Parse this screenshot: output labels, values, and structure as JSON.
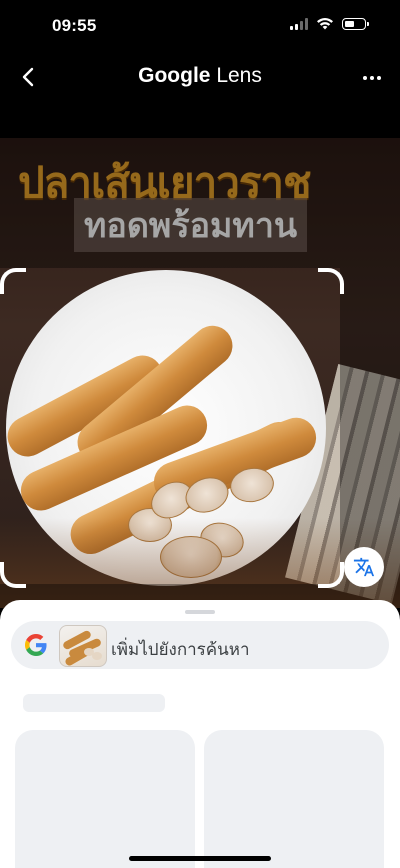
{
  "status_bar": {
    "time": "09:55",
    "icons": [
      "cellular-signal-icon",
      "wifi-icon",
      "battery-icon"
    ]
  },
  "nav": {
    "back_icon": "chevron-left-icon",
    "title_brand": "Google",
    "title_product": "Lens",
    "more_icon": "more-horizontal-icon"
  },
  "photo": {
    "banner_text": "ปลาเส้นเยาวราช",
    "subbanner_text": "ทอดพร้อมทาน"
  },
  "translate_button": {
    "icon": "translate-icon"
  },
  "sheet": {
    "search_pill": {
      "logo": "google-g-icon",
      "label": "เพิ่มไปยังการค้นหา"
    }
  },
  "colors": {
    "background": "#000000",
    "sheet": "#ffffff",
    "pill": "#eef0f3",
    "translate_blue": "#1a73e8",
    "banner_orange": "#e7a12a"
  }
}
